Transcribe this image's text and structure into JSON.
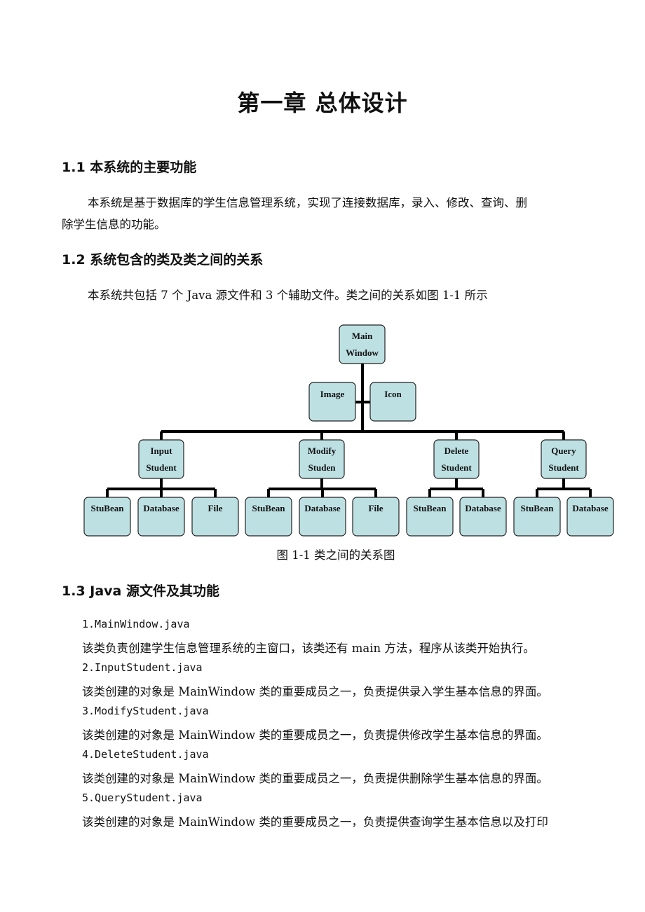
{
  "chapter_title": "第一章  总体设计",
  "sections": [
    {
      "heading": "1.1 本系统的主要功能",
      "paragraph_line1": "本系统是基于数据库的学生信息管理系统，实现了连接数据库，录入、修改、查询、删",
      "paragraph_line2": "除学生信息的功能。"
    },
    {
      "heading": "1.2 系统包含的类及类之间的关系",
      "paragraph": "本系统共包括 7 个 Java 源文件和 3 个辅助文件。类之间的关系如图 1-1 所示"
    },
    {
      "heading": "1.3 Java 源文件及其功能",
      "files": [
        {
          "name": "1.MainWindow.java",
          "desc": "该类负责创建学生信息管理系统的主窗口，该类还有 main 方法，程序从该类开始执行。"
        },
        {
          "name": "2.InputStudent.java",
          "desc": "该类创建的对象是 MainWindow 类的重要成员之一，负责提供录入学生基本信息的界面。"
        },
        {
          "name": "3.ModifyStudent.java",
          "desc": "该类创建的对象是 MainWindow 类的重要成员之一，负责提供修改学生基本信息的界面。"
        },
        {
          "name": "4.DeleteStudent.java",
          "desc": "该类创建的对象是 MainWindow 类的重要成员之一，负责提供删除学生基本信息的界面。"
        },
        {
          "name": "5.QueryStudent.java",
          "desc": "该类创建的对象是 MainWindow 类的重要成员之一，负责提供查询学生基本信息以及打印"
        }
      ]
    }
  ],
  "diagram": {
    "caption": "图  1-1  类之间的关系图",
    "box_fill": "#bde0e3",
    "line_color": "#000000",
    "root": {
      "label_lines": [
        "Main",
        "Window"
      ]
    },
    "assistants": [
      {
        "label_lines": [
          "Image"
        ]
      },
      {
        "label_lines": [
          "Icon"
        ]
      }
    ],
    "children": [
      {
        "label_lines": [
          "Input",
          "Student"
        ],
        "leaves": [
          "StuBean",
          "Database",
          "File"
        ]
      },
      {
        "label_lines": [
          "Modify",
          "Studen"
        ],
        "leaves": [
          "StuBean",
          "Database",
          "File"
        ]
      },
      {
        "label_lines": [
          "Delete",
          "Student"
        ],
        "leaves": [
          "StuBean",
          "Database"
        ]
      },
      {
        "label_lines": [
          "Query",
          "Student"
        ],
        "leaves": [
          "StuBean",
          "Database"
        ]
      }
    ]
  }
}
